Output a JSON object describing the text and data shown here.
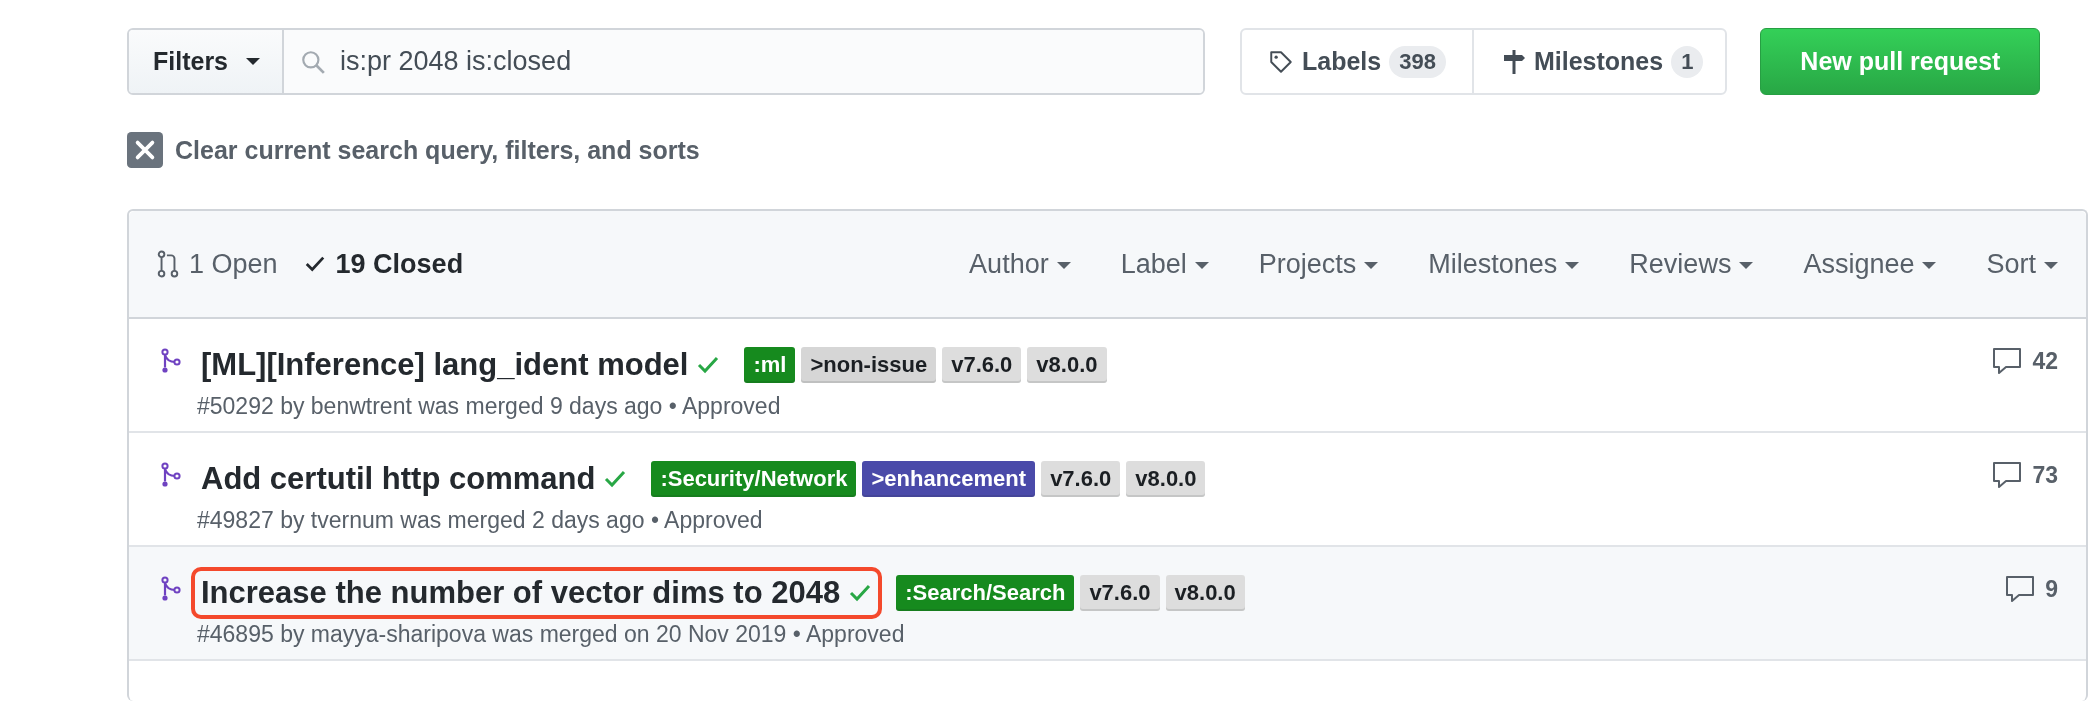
{
  "filters_button": "Filters",
  "search": {
    "value": "is:pr 2048 is:closed"
  },
  "labels_tab": {
    "label": "Labels",
    "count": "398"
  },
  "milestones_tab": {
    "label": "Milestones",
    "count": "1"
  },
  "new_button": "New pull request",
  "clear_link": "Clear current search query, filters, and sorts",
  "states": [
    {
      "label": "1 Open",
      "selected": false
    },
    {
      "label": "19 Closed",
      "selected": true
    }
  ],
  "filter_menus": [
    "Author",
    "Label",
    "Projects",
    "Milestones",
    "Reviews",
    "Assignee",
    "Sort"
  ],
  "pull_requests": [
    {
      "title": "[ML][Inference] lang_ident model",
      "highlighted": false,
      "meta": "#50292 by benwtrent was merged 9 days ago • Approved",
      "comments": "42",
      "labels": [
        {
          "name": ":ml",
          "color": "#168a1e"
        },
        {
          "name": ">non-issue",
          "color": "#d6d6d6"
        },
        {
          "name": "v7.6.0",
          "color": "#dddddd"
        },
        {
          "name": "v8.0.0",
          "color": "#dddddd"
        }
      ]
    },
    {
      "title": "Add certutil http command",
      "highlighted": false,
      "meta": "#49827 by tvernum was merged 2 days ago • Approved",
      "comments": "73",
      "labels": [
        {
          "name": ":Security/Network",
          "color": "#168a1e"
        },
        {
          "name": ">enhancement",
          "color": "#4a4aa9"
        },
        {
          "name": "v7.6.0",
          "color": "#dddddd"
        },
        {
          "name": "v8.0.0",
          "color": "#dddddd"
        }
      ]
    },
    {
      "title": "Increase the number of vector dims to 2048",
      "highlighted": true,
      "meta": "#46895 by mayya-sharipova was merged on 20 Nov 2019 • Approved",
      "comments": "9",
      "labels": [
        {
          "name": ":Search/Search",
          "color": "#168a1e"
        },
        {
          "name": "v7.6.0",
          "color": "#dddddd"
        },
        {
          "name": "v8.0.0",
          "color": "#dddddd"
        }
      ]
    }
  ]
}
